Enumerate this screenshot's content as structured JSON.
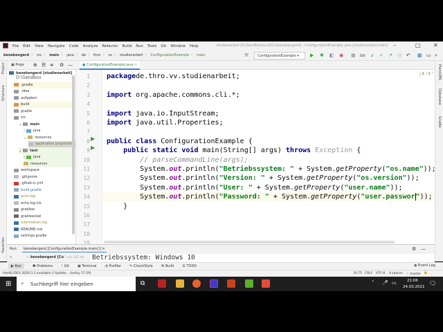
{
  "menu": {
    "items": [
      "File",
      "Edit",
      "View",
      "Navigate",
      "Code",
      "Analyze",
      "Refactor",
      "Build",
      "Run",
      "Tools",
      "Git",
      "Window",
      "Help"
    ],
    "title": "studienarbeit [D:\\Sandbox\\vv2021\\benekengerd] - ConfigurationExample.java [studienarbeit.main]"
  },
  "breadcrumb": [
    "benekengerd",
    "src",
    "main",
    "java",
    "de",
    "thro",
    "vv",
    "studienarbeit",
    "ConfigurationExample",
    "main"
  ],
  "toolbar": {
    "run_config": "ConfigurationExample",
    "git_label": "Git:"
  },
  "project": {
    "header": "Proje",
    "root": "benekengerd [studienarbeit]",
    "root_path": "D:\\Sandbox",
    "items": [
      {
        "label": ".gradle",
        "depth": 1,
        "color": "#e08f46",
        "hl": true
      },
      {
        "label": ".idea",
        "depth": 1,
        "color": "#999"
      },
      {
        "label": "aufgaben",
        "depth": 1,
        "color": "#999"
      },
      {
        "label": "build",
        "depth": 1,
        "color": "#e08f46",
        "hl": true
      },
      {
        "label": "gradle",
        "depth": 1,
        "color": "#999"
      },
      {
        "label": "src",
        "depth": 1,
        "color": "#999"
      },
      {
        "label": "main",
        "depth": 2,
        "color": "#999",
        "bold": true,
        "arrow": "v"
      },
      {
        "label": "java",
        "depth": 3,
        "color": "#5aa7d8",
        "arrow": ">"
      },
      {
        "label": "resources",
        "depth": 3,
        "color": "#c9b26b",
        "arrow": "v"
      },
      {
        "label": "application.properties",
        "depth": 4,
        "color": "#bbb",
        "sel": true
      },
      {
        "label": "test",
        "depth": 2,
        "color": "#999",
        "bold": true,
        "arrow": "v",
        "green": true
      },
      {
        "label": "java",
        "depth": 3,
        "color": "#62b543",
        "arrow": ">",
        "green": true
      },
      {
        "label": "resources",
        "depth": 3,
        "color": "#c9b26b",
        "green": true
      },
      {
        "label": "workspace",
        "depth": 1,
        "color": "#999"
      },
      {
        "label": ".gitignore",
        "depth": 1,
        "color": "#bbb"
      },
      {
        "label": ".gitlab-ci.yml",
        "depth": 1,
        "color": "#c33"
      },
      {
        "label": "build.gradle",
        "depth": 1,
        "color": "#8ab",
        "tc": "#3b6ea5"
      },
      {
        "label": "echo.log",
        "depth": 1,
        "color": "#3b6ea5",
        "tc": "#8a8a2a"
      },
      {
        "label": "echo.log.lck",
        "depth": 1,
        "color": "#bbb"
      },
      {
        "label": "gradlew",
        "depth": 1,
        "color": "#888"
      },
      {
        "label": "gradlew.bat",
        "depth": 1,
        "color": "#666"
      },
      {
        "label": "information.log",
        "depth": 1,
        "color": "#3b6ea5",
        "tc": "#8a8a2a"
      },
      {
        "label": "README.md",
        "depth": 1,
        "color": "#3b6ea5"
      },
      {
        "label": "settings.gradle",
        "depth": 1,
        "color": "#8ab"
      }
    ]
  },
  "editor": {
    "tab": "ConfigurationExample.java",
    "warnings": "2",
    "checks": "1",
    "lines": [
      [
        [
          "kw",
          "package"
        ],
        [
          "",
          "de.thro.vv.studienarbeit;"
        ]
      ],
      [],
      [
        [
          "kw",
          "import"
        ],
        [
          "",
          " org.apache.commons.cli.*;"
        ]
      ],
      [],
      [
        [
          "kw",
          "import"
        ],
        [
          "",
          " java.io.InputStream;"
        ]
      ],
      [
        [
          "kw",
          "import"
        ],
        [
          "",
          " java.util.Properties;"
        ]
      ],
      [],
      [
        [
          "kw",
          "public class"
        ],
        [
          "",
          " ConfigurationExample {"
        ]
      ],
      [
        [
          "",
          "    "
        ],
        [
          "kw",
          "public static void"
        ],
        [
          "",
          " main(String[] args) "
        ],
        [
          "kw",
          "throws"
        ],
        [
          "gr",
          " Exception"
        ],
        [
          "",
          " {"
        ]
      ],
      [
        [
          "cm",
          "        // parseCommandLine(args);"
        ]
      ],
      [
        [
          "",
          "        System."
        ],
        [
          "st",
          "out"
        ],
        [
          "",
          ".println("
        ],
        [
          "str",
          "\"Betriebssystem: \""
        ],
        [
          "",
          " + System."
        ],
        [
          "it",
          "getProperty"
        ],
        [
          "",
          "("
        ],
        [
          "str",
          "\"os.name\""
        ],
        [
          "",
          "));"
        ]
      ],
      [
        [
          "",
          "        System."
        ],
        [
          "st",
          "out"
        ],
        [
          "",
          ".println("
        ],
        [
          "str",
          "\"Version: \""
        ],
        [
          "",
          " + System."
        ],
        [
          "it",
          "getProperty"
        ],
        [
          "",
          "("
        ],
        [
          "str",
          "\"os.version\""
        ],
        [
          "",
          "));"
        ]
      ],
      [
        [
          "",
          "        System."
        ],
        [
          "st",
          "out"
        ],
        [
          "",
          ".println("
        ],
        [
          "str",
          "\"User: \""
        ],
        [
          "",
          " + System."
        ],
        [
          "it",
          "getProperty"
        ],
        [
          "",
          "("
        ],
        [
          "str",
          "\"user.name\""
        ],
        [
          "",
          "));"
        ]
      ],
      [
        [
          "",
          "        System."
        ],
        [
          "st",
          "out"
        ],
        [
          "",
          ".println("
        ],
        [
          "str",
          "\"Password: \""
        ],
        [
          "",
          " + System."
        ],
        [
          "it",
          "getProperty"
        ],
        [
          "",
          "("
        ],
        [
          "str",
          "\"user.passwor"
        ],
        [
          "caret",
          ""
        ],
        [
          "str",
          "\""
        ],
        [
          "",
          "));"
        ]
      ],
      [
        [
          "",
          "    }"
        ]
      ],
      [],
      [],
      [],
      []
    ]
  },
  "right_strip": [
    "PlantUML",
    "Database",
    "Gradle"
  ],
  "left_strip": [
    "Project",
    "Structure",
    "Favorites"
  ],
  "run": {
    "label": "Run:",
    "tab": "benekengerd [ConfigurationExample.main()]",
    "tree_item": "benekengerd [Co",
    "tree_time": "1 sec, 621 ms",
    "output": "Betriebssystem: Windows 10"
  },
  "tooltabs": [
    "Run",
    "Problems",
    "Git",
    "Terminal",
    "Profiler",
    "CheckStyle",
    "Build",
    "TODO"
  ],
  "event_log": "Event Log",
  "status": {
    "message": "IntelliJ IDEA 2020.3.3 available // Update... (today 17:29)",
    "position": "14:75",
    "line_sep": "CRLF",
    "encoding": "UTF-8",
    "indent": "4 spaces",
    "branch": "master"
  },
  "taskbar": {
    "search_placeholder": "Suchbegriff hier eingeben",
    "time": "21:06",
    "date": "24.03.2021"
  }
}
